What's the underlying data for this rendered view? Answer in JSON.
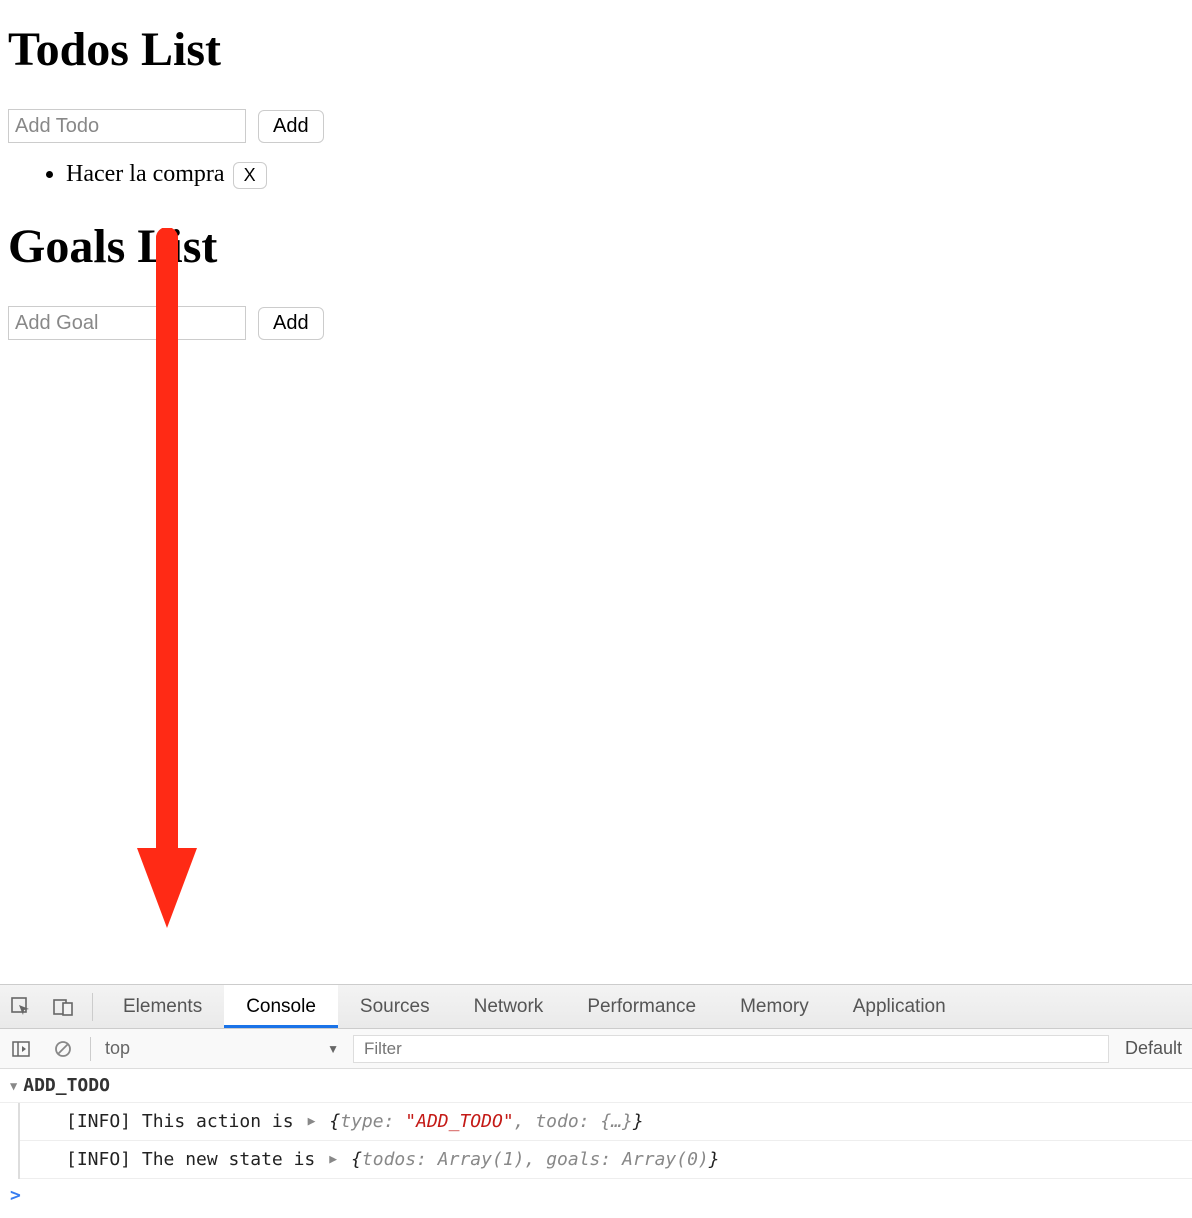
{
  "todos": {
    "heading": "Todos List",
    "input_placeholder": "Add Todo",
    "add_label": "Add",
    "items": [
      {
        "text": "Hacer la compra",
        "delete_label": "X"
      }
    ]
  },
  "goals": {
    "heading": "Goals List",
    "input_placeholder": "Add Goal",
    "add_label": "Add"
  },
  "devtools": {
    "tabs": {
      "elements": "Elements",
      "console": "Console",
      "sources": "Sources",
      "network": "Network",
      "performance": "Performance",
      "memory": "Memory",
      "application": "Application"
    },
    "toolbar": {
      "context": "top",
      "filter_placeholder": "Filter",
      "levels_label": "Default"
    },
    "console": {
      "group_title": "ADD_TODO",
      "lines": [
        {
          "prefix": "[INFO] This action is ",
          "obj_open": "{",
          "k1": "type:",
          "v1": "\"ADD_TODO\"",
          "sep1": ", ",
          "k2": "todo:",
          "v2": "{…}",
          "obj_close": "}"
        },
        {
          "prefix": "[INFO] The new state is ",
          "obj_open": "{",
          "k1": "todos:",
          "v1": "Array(1)",
          "sep1": ", ",
          "k2": "goals:",
          "v2": "Array(0)",
          "obj_close": "}"
        }
      ],
      "prompt": ">"
    }
  }
}
